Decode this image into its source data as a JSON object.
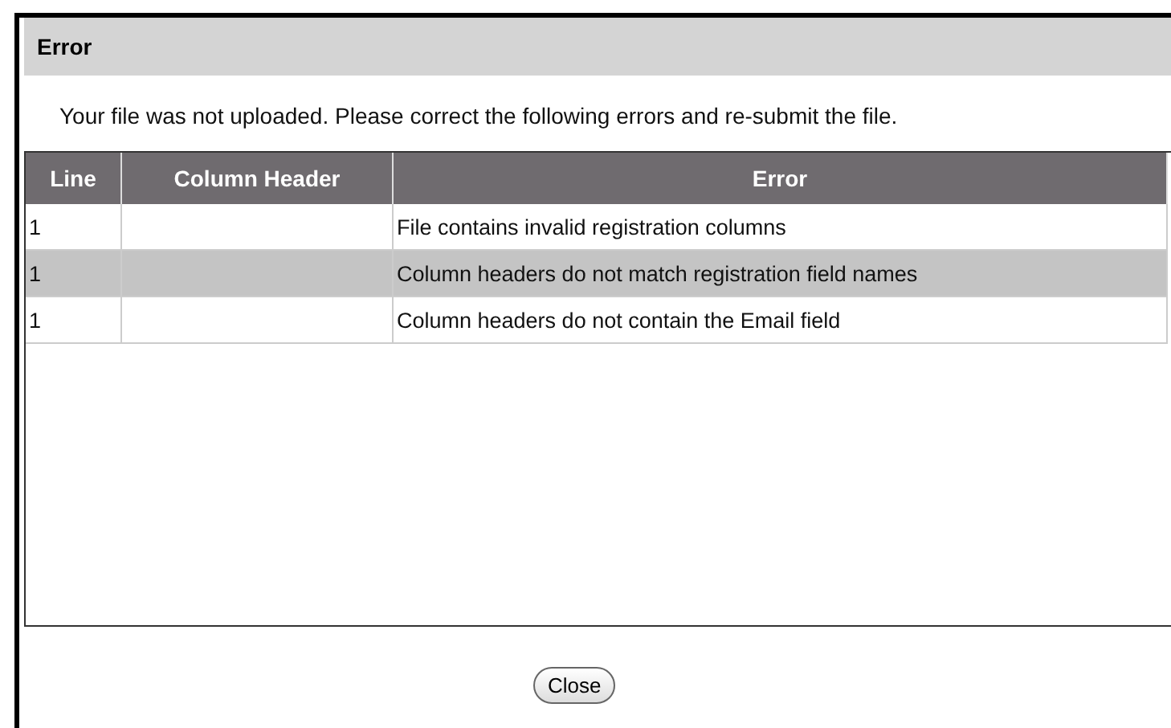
{
  "dialog": {
    "title": "Error",
    "message": "Your file was not uploaded. Please correct the following errors and re-submit the file.",
    "table": {
      "columns": [
        "Line",
        "Column Header",
        "Error"
      ],
      "rows": [
        {
          "line": "1",
          "error": "File contains invalid registration columns",
          "selected": false
        },
        {
          "line": "1",
          "error": "Column headers do not match registration field names",
          "selected": true
        },
        {
          "line": "1",
          "error": "Column headers do not contain the Email field",
          "selected": false
        }
      ]
    },
    "buttons": [
      "Close"
    ]
  }
}
